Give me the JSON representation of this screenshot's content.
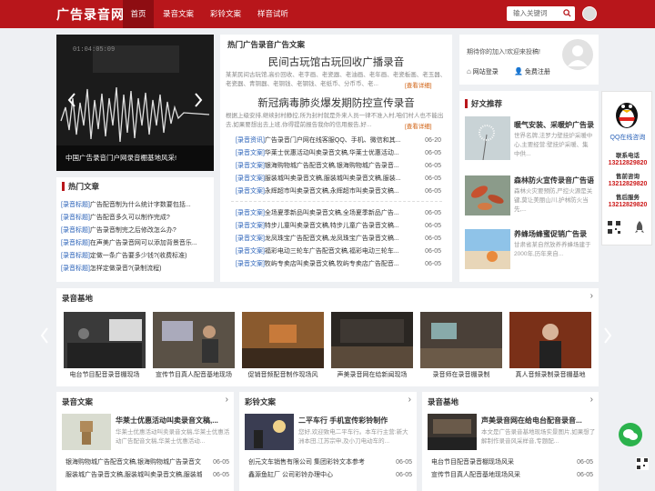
{
  "header": {
    "logo": "广告录音网",
    "nav": [
      "首页",
      "录音文案",
      "彩铃文案",
      "样音试听"
    ],
    "search_placeholder": "输入关键词"
  },
  "slider": {
    "caption": "中国广告录音门户网录音棚基地风采!"
  },
  "hot": {
    "title": "热门文章",
    "items": [
      {
        "tag": "[录音标题]",
        "text": "广告配音制为什么统计字数要包括..."
      },
      {
        "tag": "[录音标题]",
        "text": "广告配音多久可以制作完成?"
      },
      {
        "tag": "[录音标题]",
        "text": "广告录音制完之后修改怎么办?"
      },
      {
        "tag": "[录音标题]",
        "text": "在声美广告录音网可以添加背景音乐..."
      },
      {
        "tag": "[录音标题]",
        "text": "定做一条广告要多少钱?(收费标准)"
      },
      {
        "tag": "[录音标题]",
        "text": "怎样定做录音?(录制流程)"
      }
    ]
  },
  "center": {
    "title": "热门广告录音广告文案",
    "article1": {
      "headline": "民间古玩馆古玩回收广播录音",
      "summary": "某某民间古玩馆,高价回收、老字画、老瓷器、老油画、老年画、老瓷板画、老玉器、老瓷器、青铜器、老铜钱、老钢钱、老纸币、分币币、老...",
      "more": "[查看详细]"
    },
    "article2": {
      "headline": "新冠病毒肺炎爆发期防控宣传录音",
      "summary": "根据上级安排,继续封村静控,所为封村就是外来人员一律不准入村,咱们村人也不能出去,如果要想出去上班,你得提前报告我你的信用报告,好...",
      "more": "[查看详细]"
    },
    "list1": [
      {
        "tag": "[录音资讯]",
        "text": "广告录音门户网在线客服QQ、手机、微信和其...",
        "date": "06-20"
      },
      {
        "tag": "[录音文案]",
        "text": "华莱士优惠活动叫卖录音文稿,华莱士优惠活动...",
        "date": "06-05"
      },
      {
        "tag": "[录音文案]",
        "text": "银海购物城广告配音文稿,银海购物城广告录音...",
        "date": "06-05"
      },
      {
        "tag": "[录音文案]",
        "text": "服装城叫卖录音文稿,服装城叫卖录音文稿,服装...",
        "date": "06-05"
      },
      {
        "tag": "[录音文案]",
        "text": "永辉超市叫卖录音文稿,永辉超市叫卖录音文稿...",
        "date": "06-05"
      }
    ],
    "list2": [
      {
        "tag": "[录音文案]",
        "text": "全场夏季新品叫卖录音文稿,全场夏季新品广告...",
        "date": "06-05"
      },
      {
        "tag": "[录音文案]",
        "text": "特步儿童叫卖录音文稿,特步儿童广告录音文稿...",
        "date": "06-05"
      },
      {
        "tag": "[录音文案]",
        "text": "龙凤珠宝广告配音文稿,龙凤珠宝广告录音文稿...",
        "date": "06-05"
      },
      {
        "tag": "[录音文案]",
        "text": "福彩电动三轮车广告配音文稿,福彩电动三轮车...",
        "date": "06-05"
      },
      {
        "tag": "[录音文案]",
        "text": "牧屿专卖店叫卖录音文稿,牧屿专卖店广告配音...",
        "date": "06-05"
      }
    ]
  },
  "profile": {
    "greeting": "期待你的加入!欢迎来投稿!",
    "login": "网站登录",
    "register": "免费注册"
  },
  "recommend": {
    "title": "好文推荐",
    "items": [
      {
        "title": "暖气安装、采暖炉广告录",
        "desc": "世界名牌,法罗力壁挂炉采暖中心,主要经营:壁挂炉采暖、集中供..."
      },
      {
        "title": "森林防火宣传录音广告语",
        "desc": "森林火灾要预防,严控火源是关键,莫让美丽山川,护林防火当先,..."
      },
      {
        "title": "养蜂场蜂蜜促销广告录",
        "desc": "甘肃省某自然放养养蜂场建于2000年,历年来自..."
      }
    ]
  },
  "float": {
    "qq": "QQ在线咨询",
    "contact": "联系电话",
    "phone1": "13212829820",
    "pre": "售前咨询",
    "phone2": "13212829820",
    "after": "售后服务",
    "phone3": "13212829820"
  },
  "studio": {
    "title": "录音基地",
    "items": [
      "电台节目配音录音棚现场",
      "宣传节目真人配音基地现场",
      "促销音频配音制作现场风",
      "声美录音网在给新闻现场",
      "录音师在录音棚录制",
      "真人音频录制录音棚基地"
    ]
  },
  "bottom": {
    "col1": {
      "title": "录音文案",
      "feature_title": "华莱士优惠活动叫卖录音文稿,...",
      "feature_desc": "华莱士优惠活动叫卖录音文稿,华莱士优惠活动广告配音文稿,华莱士优惠活动...",
      "items": [
        {
          "text": "银海购物城广告配音文稿,银海购物城广告录音文",
          "date": "06-05"
        },
        {
          "text": "服装城广告录音文稿,服装城叫卖录音文稿,服装城",
          "date": "06-05"
        }
      ]
    },
    "col2": {
      "title": "彩铃文案",
      "feature_title": "二平车行 手机宣传彩铃制作",
      "feature_desc": "您好,欢迎致电二平车行。本车行主营:新大洲本田,江苏宗申,及小刀电动车的...",
      "items": [
        {
          "text": "创元文车销售有限公司 集团彩铃文本参考",
          "date": "06-05"
        },
        {
          "text": "鑫源鱼缸厂 公司彩铃办理中心",
          "date": "06-05"
        }
      ]
    },
    "col3": {
      "title": "录音基地",
      "feature_title": "声美录音网在给电台配音录音...",
      "feature_desc": "本文是广告录音基地现场实景图片,如果想了解制作录音风采样音,专题配...",
      "items": [
        {
          "text": "电台节目配音录音棚现场风采",
          "date": "06-05"
        },
        {
          "text": "宣传节目真人配音基地现场风采",
          "date": "06-05"
        }
      ]
    }
  },
  "colors": {
    "brand": "#b8161b",
    "link": "#2a62b8",
    "tel": "#cc1a1a"
  }
}
